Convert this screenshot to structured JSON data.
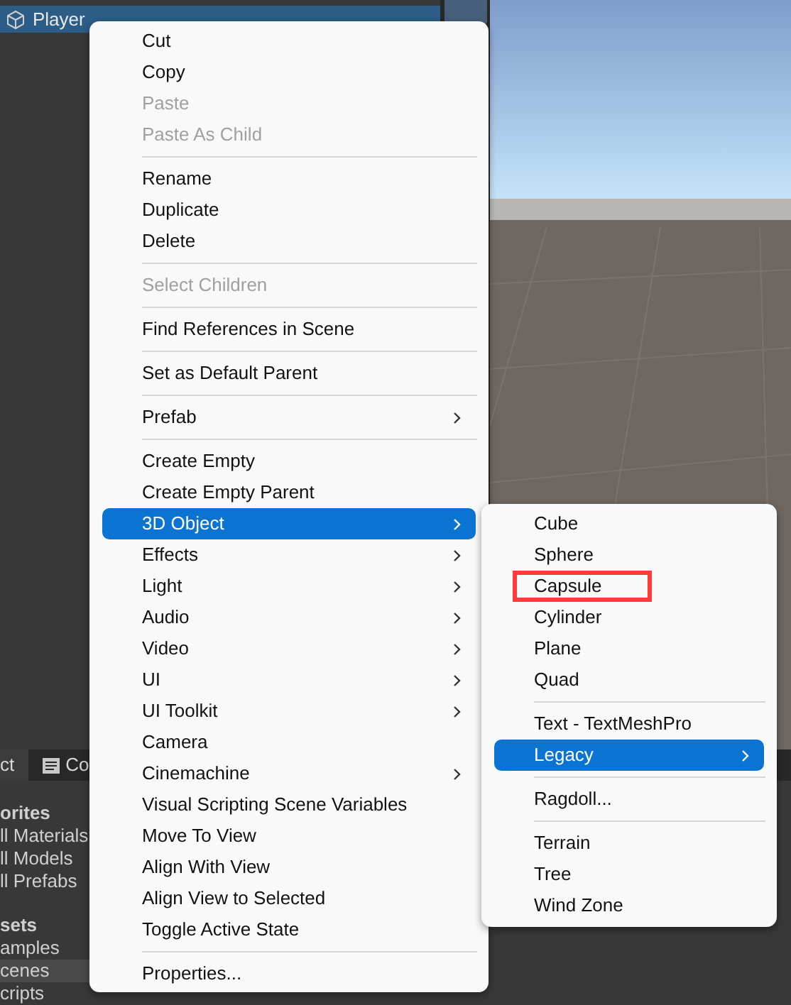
{
  "hierarchy": {
    "items": [
      {
        "label": "Player",
        "selected": true
      }
    ]
  },
  "bottom_panel": {
    "tabs": [
      {
        "label": "ct",
        "selected": true
      },
      {
        "label": "Co",
        "selected": false
      }
    ],
    "items": [
      {
        "label": "orites",
        "kind": "header",
        "selected": false
      },
      {
        "label": "ll Materials",
        "kind": "item",
        "selected": false
      },
      {
        "label": "ll Models",
        "kind": "item",
        "selected": false
      },
      {
        "label": "ll Prefabs",
        "kind": "item",
        "selected": false
      },
      {
        "label": "sets",
        "kind": "header",
        "selected": false
      },
      {
        "label": "amples",
        "kind": "item",
        "selected": false
      },
      {
        "label": "cenes",
        "kind": "item",
        "selected": true
      },
      {
        "label": "cripts",
        "kind": "item",
        "selected": false
      }
    ]
  },
  "context_menu": {
    "items": [
      {
        "kind": "item",
        "label": "Cut",
        "disabled": false,
        "submenu": false,
        "selected": false
      },
      {
        "kind": "item",
        "label": "Copy",
        "disabled": false,
        "submenu": false,
        "selected": false
      },
      {
        "kind": "item",
        "label": "Paste",
        "disabled": true,
        "submenu": false,
        "selected": false
      },
      {
        "kind": "item",
        "label": "Paste As Child",
        "disabled": true,
        "submenu": false,
        "selected": false
      },
      {
        "kind": "separator"
      },
      {
        "kind": "item",
        "label": "Rename",
        "disabled": false,
        "submenu": false,
        "selected": false
      },
      {
        "kind": "item",
        "label": "Duplicate",
        "disabled": false,
        "submenu": false,
        "selected": false
      },
      {
        "kind": "item",
        "label": "Delete",
        "disabled": false,
        "submenu": false,
        "selected": false
      },
      {
        "kind": "separator"
      },
      {
        "kind": "item",
        "label": "Select Children",
        "disabled": true,
        "submenu": false,
        "selected": false
      },
      {
        "kind": "separator"
      },
      {
        "kind": "item",
        "label": "Find References in Scene",
        "disabled": false,
        "submenu": false,
        "selected": false
      },
      {
        "kind": "separator"
      },
      {
        "kind": "item",
        "label": "Set as Default Parent",
        "disabled": false,
        "submenu": false,
        "selected": false
      },
      {
        "kind": "separator"
      },
      {
        "kind": "item",
        "label": "Prefab",
        "disabled": false,
        "submenu": true,
        "selected": false
      },
      {
        "kind": "separator"
      },
      {
        "kind": "item",
        "label": "Create Empty",
        "disabled": false,
        "submenu": false,
        "selected": false
      },
      {
        "kind": "item",
        "label": "Create Empty Parent",
        "disabled": false,
        "submenu": false,
        "selected": false
      },
      {
        "kind": "item",
        "label": "3D Object",
        "disabled": false,
        "submenu": true,
        "selected": true
      },
      {
        "kind": "item",
        "label": "Effects",
        "disabled": false,
        "submenu": true,
        "selected": false
      },
      {
        "kind": "item",
        "label": "Light",
        "disabled": false,
        "submenu": true,
        "selected": false
      },
      {
        "kind": "item",
        "label": "Audio",
        "disabled": false,
        "submenu": true,
        "selected": false
      },
      {
        "kind": "item",
        "label": "Video",
        "disabled": false,
        "submenu": true,
        "selected": false
      },
      {
        "kind": "item",
        "label": "UI",
        "disabled": false,
        "submenu": true,
        "selected": false
      },
      {
        "kind": "item",
        "label": "UI Toolkit",
        "disabled": false,
        "submenu": true,
        "selected": false
      },
      {
        "kind": "item",
        "label": "Camera",
        "disabled": false,
        "submenu": false,
        "selected": false
      },
      {
        "kind": "item",
        "label": "Cinemachine",
        "disabled": false,
        "submenu": true,
        "selected": false
      },
      {
        "kind": "item",
        "label": "Visual Scripting Scene Variables",
        "disabled": false,
        "submenu": false,
        "selected": false
      },
      {
        "kind": "item",
        "label": "Move To View",
        "disabled": false,
        "submenu": false,
        "selected": false
      },
      {
        "kind": "item",
        "label": "Align With View",
        "disabled": false,
        "submenu": false,
        "selected": false
      },
      {
        "kind": "item",
        "label": "Align View to Selected",
        "disabled": false,
        "submenu": false,
        "selected": false
      },
      {
        "kind": "item",
        "label": "Toggle Active State",
        "disabled": false,
        "submenu": false,
        "selected": false
      },
      {
        "kind": "separator"
      },
      {
        "kind": "item",
        "label": "Properties...",
        "disabled": false,
        "submenu": false,
        "selected": false
      }
    ]
  },
  "submenu": {
    "items": [
      {
        "kind": "item",
        "label": "Cube",
        "submenu": false,
        "selected": false,
        "highlighted": false
      },
      {
        "kind": "item",
        "label": "Sphere",
        "submenu": false,
        "selected": false,
        "highlighted": false
      },
      {
        "kind": "item",
        "label": "Capsule",
        "submenu": false,
        "selected": false,
        "highlighted": true
      },
      {
        "kind": "item",
        "label": "Cylinder",
        "submenu": false,
        "selected": false,
        "highlighted": false
      },
      {
        "kind": "item",
        "label": "Plane",
        "submenu": false,
        "selected": false,
        "highlighted": false
      },
      {
        "kind": "item",
        "label": "Quad",
        "submenu": false,
        "selected": false,
        "highlighted": false
      },
      {
        "kind": "separator"
      },
      {
        "kind": "item",
        "label": "Text - TextMeshPro",
        "submenu": false,
        "selected": false,
        "highlighted": false
      },
      {
        "kind": "item",
        "label": "Legacy",
        "submenu": true,
        "selected": true,
        "highlighted": false
      },
      {
        "kind": "separator"
      },
      {
        "kind": "item",
        "label": "Ragdoll...",
        "submenu": false,
        "selected": false,
        "highlighted": false
      },
      {
        "kind": "separator"
      },
      {
        "kind": "item",
        "label": "Terrain",
        "submenu": false,
        "selected": false,
        "highlighted": false
      },
      {
        "kind": "item",
        "label": "Tree",
        "submenu": false,
        "selected": false,
        "highlighted": false
      },
      {
        "kind": "item",
        "label": "Wind Zone",
        "submenu": false,
        "selected": false,
        "highlighted": false
      }
    ]
  }
}
